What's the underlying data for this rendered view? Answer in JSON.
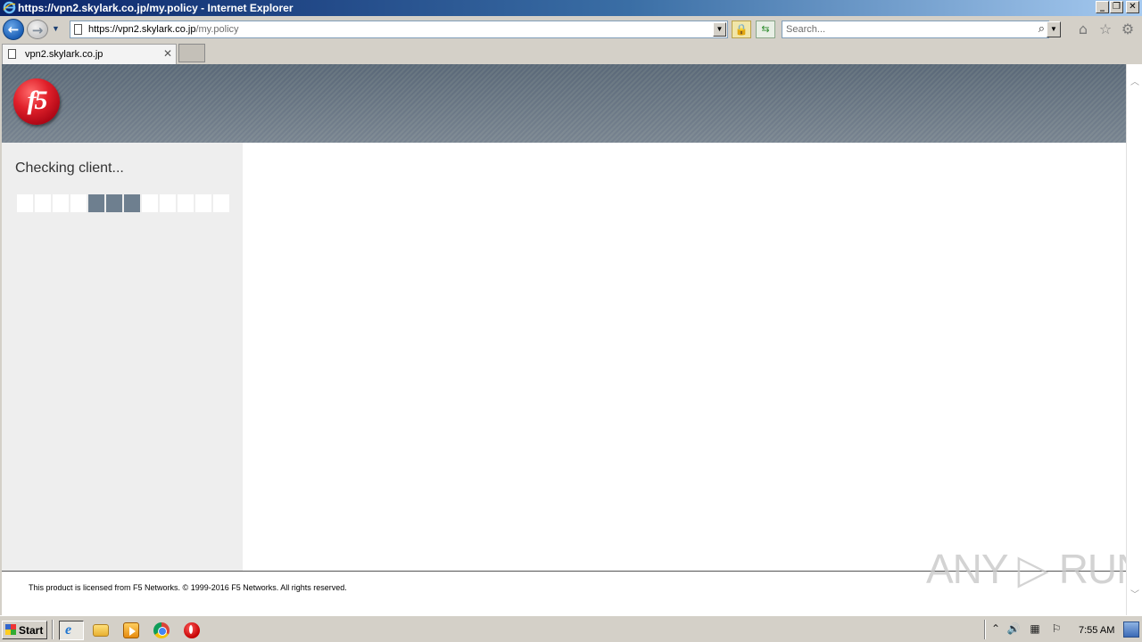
{
  "window": {
    "title": "https://vpn2.skylark.co.jp/my.policy - Internet Explorer",
    "minimize": "_",
    "restore": "❐",
    "close": "✕"
  },
  "nav": {
    "back_icon": "back-arrow-icon",
    "forward_icon": "forward-arrow-icon",
    "url_host": "https://vpn2.skylark.co.jp",
    "url_path": "/my.policy",
    "search_placeholder": "Search..."
  },
  "tabs": [
    {
      "label": "vpn2.skylark.co.jp",
      "active": true
    }
  ],
  "page": {
    "status_text": "Checking client...",
    "progress": {
      "segments": 12,
      "active": [
        4,
        5,
        6
      ]
    },
    "footer": "This product is licensed from F5 Networks. © 1999-2016 F5 Networks. All rights reserved.",
    "logo_text": "f5"
  },
  "watermark": "ANY ▷ RUN",
  "taskbar": {
    "start_label": "Start",
    "clock": "7:55 AM"
  },
  "colors": {
    "header_bg": "#5f6d7b",
    "sidebar_bg": "#eeeeee",
    "progress_on": "#6e7f8f",
    "progress_off": "#ffffff",
    "logo_red": "#e0202a"
  }
}
